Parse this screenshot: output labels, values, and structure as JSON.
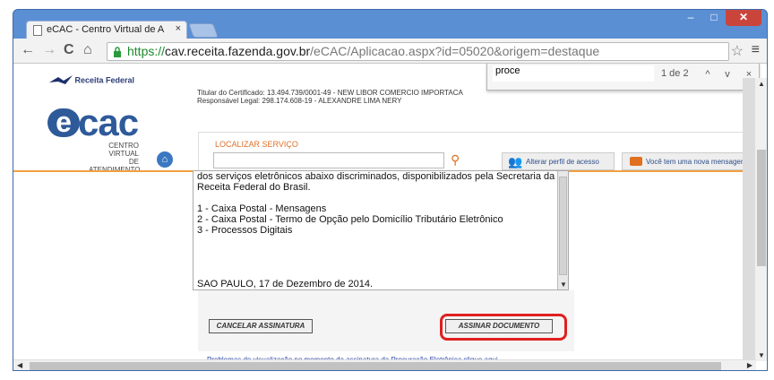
{
  "browser": {
    "tab_title": "eCAC - Centro Virtual de A",
    "tab_close": "×",
    "url_scheme": "https://",
    "url_host": "cav.receita.fazenda.gov.br",
    "url_path": "/eCAC/Aplicacao.aspx?id=05020&origem=destaque",
    "back": "←",
    "forward": "→",
    "reload": "C",
    "home": "⌂",
    "star": "☆",
    "menu": "≡",
    "minimize": "‒",
    "maximize": "□",
    "close": "✕"
  },
  "findbar": {
    "query": "proce",
    "count": "1 de 2",
    "up": "^",
    "down": "v",
    "close": "×"
  },
  "header": {
    "receita_label": "Receita Federal",
    "ecac_e": "e",
    "ecac_text": "cac",
    "ecac_sub1": "CENTRO VIRTUAL",
    "ecac_sub2": "DE ATENDIMENTO",
    "cert_line1": "Titular do Certificado: 13.494.739/0001-49 - NEW LIBOR COMERCIO IMPORTACA",
    "cert_line2": "Responsável Legal: 298.174.608-19 - ALEXANDRE LIMA NERY",
    "localizar_label": "LOCALIZAR SERVIÇO",
    "localizar_placeholder": "",
    "perfil_label": "Alterar perfil de acesso",
    "msg_label": "Você tem uma nova mensagem"
  },
  "document": {
    "line0": "dos serviços eletrônicos abaixo discriminados, disponibilizados pela Secretaria da",
    "line1": "Receita Federal do Brasil.",
    "item1": "1 - Caixa Postal - Mensagens",
    "item2": "2 - Caixa Postal - Termo de Opção pelo Domicílio Tributário Eletrônico",
    "item3": "3 - Processos Digitais",
    "date_line": "SAO PAULO, 17 de Dezembro de 2014."
  },
  "actions": {
    "cancel_label": "CANCELAR ASSINATURA",
    "sign_label": "ASSINAR DOCUMENTO",
    "problem_text": "Problemas de visualização no momento da assinatura da Procuração Eletrônica clique",
    "problem_link": "aqui",
    "problem_end": "."
  },
  "colors": {
    "accent_orange": "#f0a040",
    "brand_blue": "#2e5a9a",
    "highlight_red": "#e02020"
  }
}
